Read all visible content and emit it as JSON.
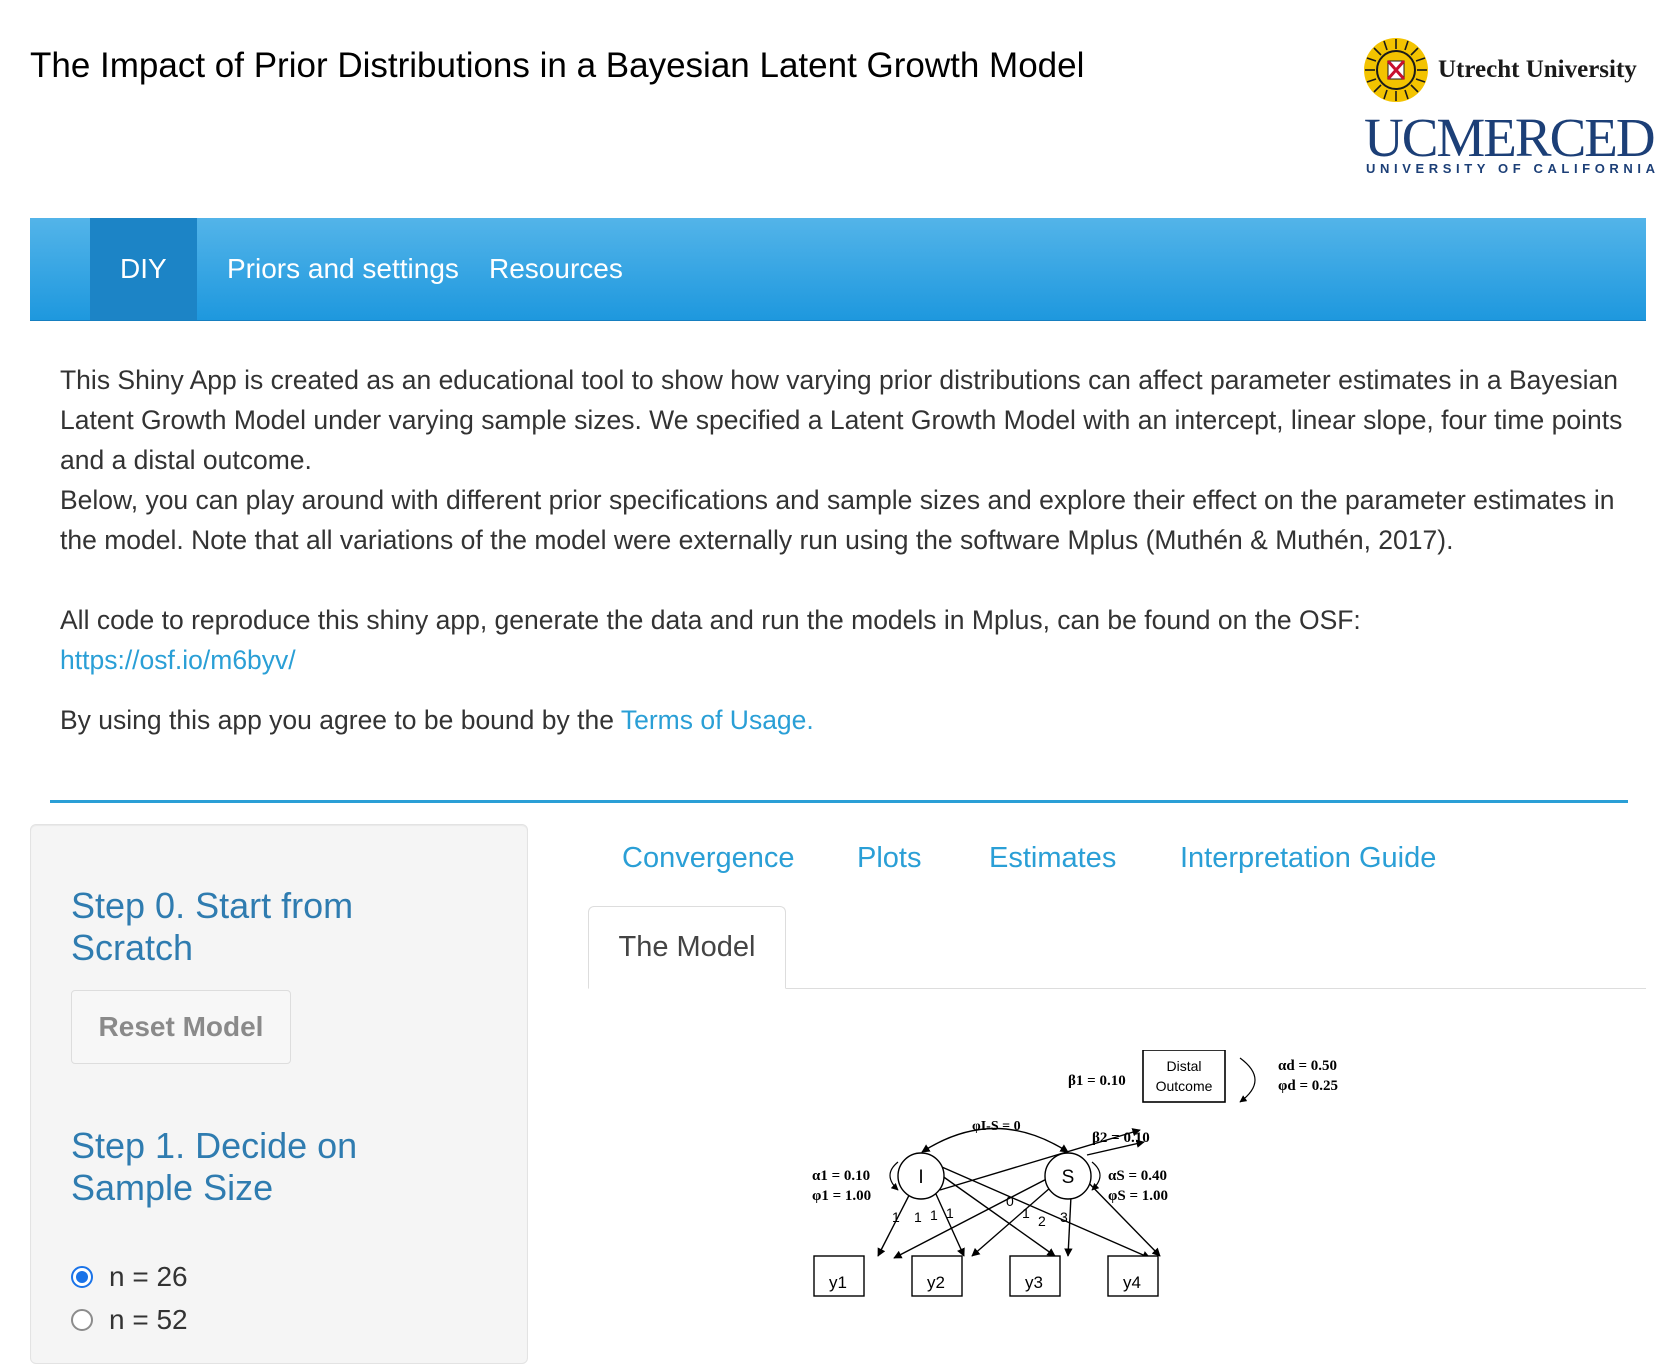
{
  "header": {
    "title": "The Impact of Prior Distributions in a Bayesian Latent Growth Model",
    "logos": {
      "uu_name": "Utrecht University",
      "ucm_name": "UCMERCED",
      "ucm_sub": "UNIVERSITY OF CALIFORNIA"
    }
  },
  "nav": {
    "items": [
      {
        "label": "DIY",
        "active": true
      },
      {
        "label": "Priors and settings",
        "active": false
      },
      {
        "label": "Resources",
        "active": false
      }
    ]
  },
  "intro": {
    "paragraph1": "This Shiny App is created as an educational tool to show how varying prior distributions can affect parameter estimates in a Bayesian Latent Growth Model under varying sample sizes. We specified a Latent Growth Model with an intercept, linear slope, four time points and a distal outcome.",
    "paragraph2": "Below, you can play around with different prior specifications and sample sizes and explore their effect on the parameter estimates in the model. Note that all variations of the model were externally run using the software Mplus (Muthén & Muthén, 2017).",
    "osf_text": "All code to reproduce this shiny app, generate the data and run the models in Mplus, can be found on the OSF:",
    "osf_link": "https://osf.io/m6byv/",
    "terms_text": "By using this app you agree to be bound by the ",
    "terms_link": "Terms of Usage."
  },
  "sidebar": {
    "step0_title": "Step 0. Start from Scratch",
    "reset_label": "Reset Model",
    "step1_title": "Step 1. Decide on Sample Size",
    "sample_sizes": [
      {
        "label": "n = 26",
        "checked": true
      },
      {
        "label": "n = 52",
        "checked": false
      }
    ]
  },
  "tabs": {
    "row1": [
      "Convergence",
      "Plots",
      "Estimates",
      "Interpretation Guide"
    ],
    "active": "The Model"
  },
  "diagram": {
    "intercept": "I",
    "slope": "S",
    "distal": [
      "Distal",
      "Outcome"
    ],
    "indicators": [
      "y1",
      "y2",
      "y3",
      "y4"
    ],
    "beta1": "β1 = 0.10",
    "beta2": "β2 = 0.10",
    "phi_is": "φI-S = 0",
    "alpha_i": "α1 = 0.10",
    "phi_i": "φ1 = 1.00",
    "alpha_s": "αS = 0.40",
    "phi_s": "φS = 1.00",
    "alpha_d": "αd = 0.50",
    "phi_d": "φd = 0.25",
    "loadings_i": [
      "1",
      "1",
      "1",
      "1"
    ],
    "loadings_s": [
      "0",
      "1",
      "2",
      "3"
    ],
    "colors": {
      "accent": "#2a9fd6",
      "step_title": "#2f7cb0",
      "nav_active": "#1c84c6"
    }
  }
}
